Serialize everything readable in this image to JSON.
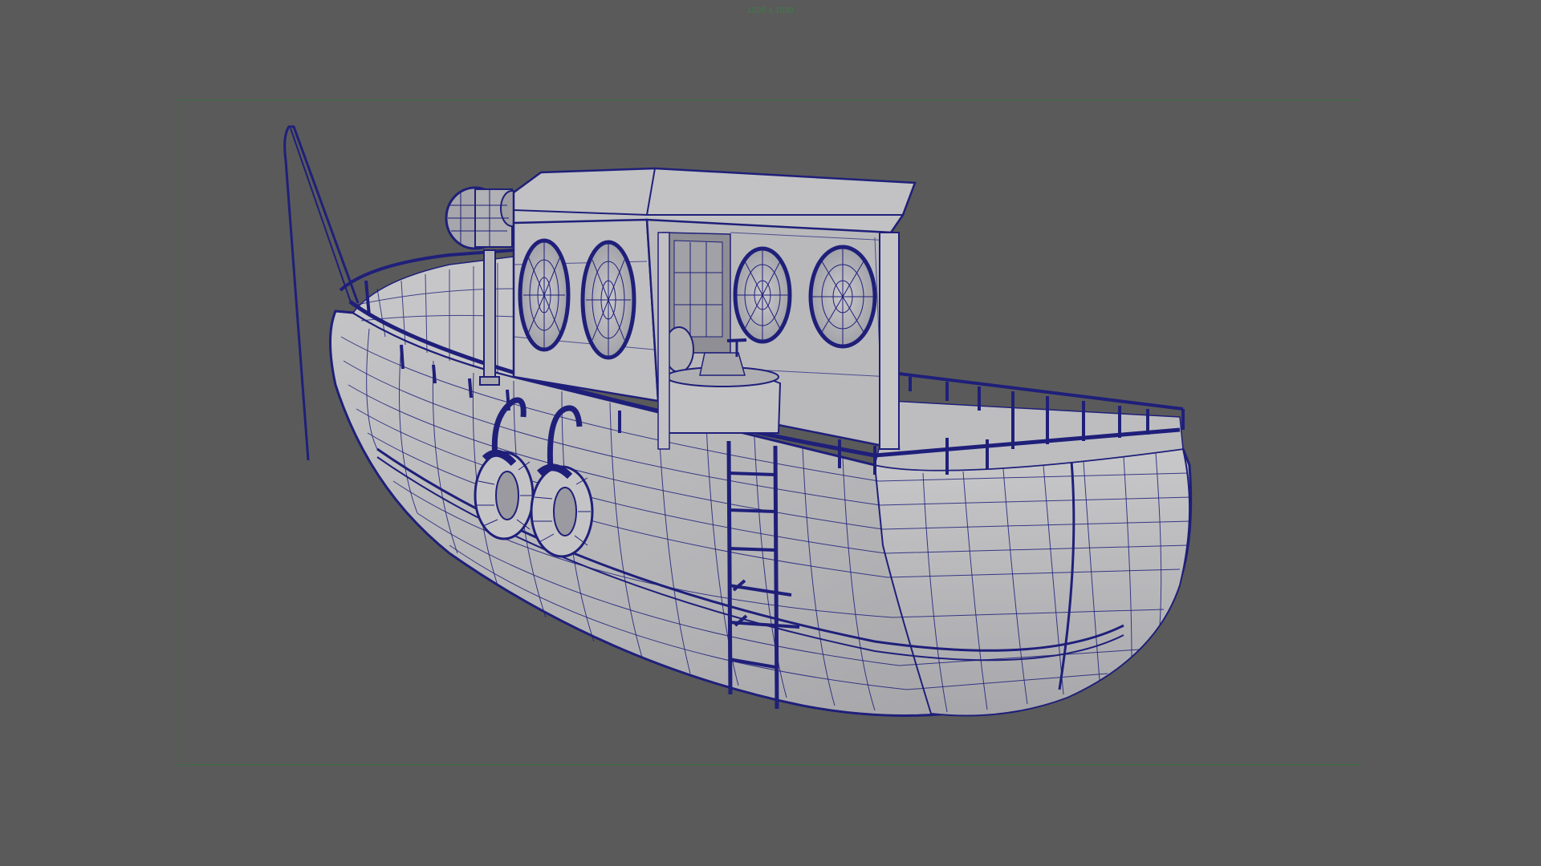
{
  "viewport": {
    "resolution_label": "1920 x 1080",
    "gate_color": "#3c6e44",
    "label_color": "#3f7d4a",
    "background_color": "#5a5a5a"
  },
  "model": {
    "wire_color": "#1f1f7a",
    "shade_color": "#b9b9bb",
    "shade_dark": "#9d9da1",
    "parts": [
      "hull",
      "cabin",
      "portholes",
      "railing",
      "ladder",
      "life-rings",
      "fishing-rod",
      "searchlight",
      "mast"
    ]
  }
}
